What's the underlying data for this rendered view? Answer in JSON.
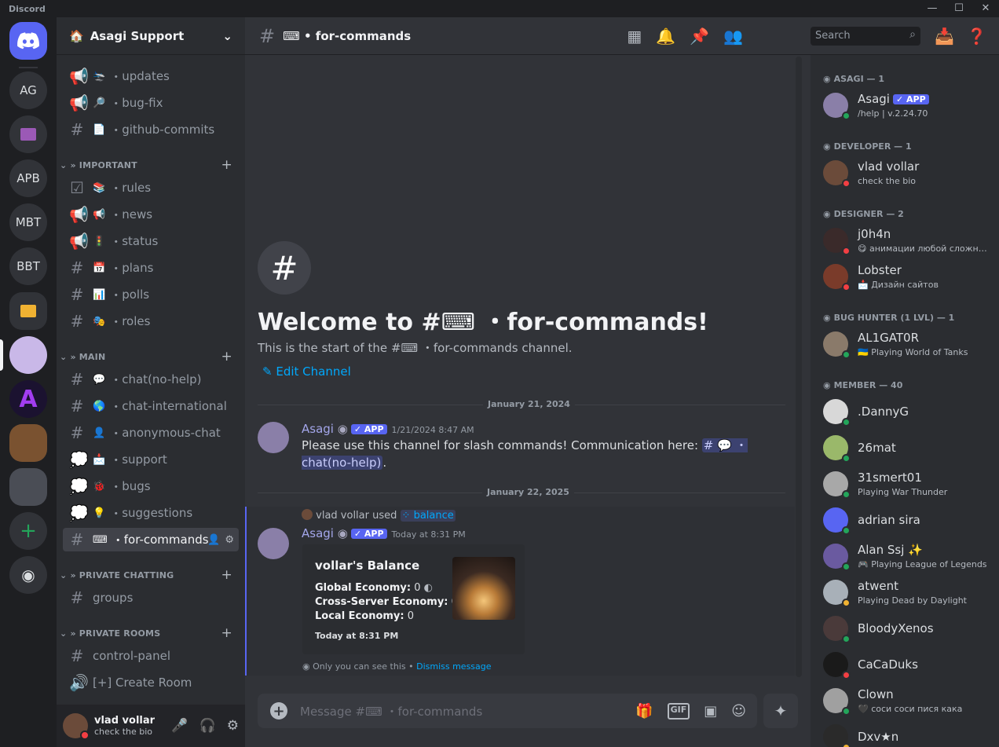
{
  "app": {
    "title": "Discord"
  },
  "window_controls": {
    "minimize": "—",
    "maximize": "☐",
    "close": "✕"
  },
  "guilds": [
    {
      "label": "",
      "icon": "discord-logo-icon"
    },
    {
      "label": "AG"
    },
    {
      "label": "■"
    },
    {
      "label": "APB"
    },
    {
      "label": "MBT"
    },
    {
      "label": "BBT"
    },
    {
      "label": "■"
    }
  ],
  "server": {
    "name": "Asagi Support"
  },
  "channels_top": [
    {
      "label": "updates",
      "emoji": "🛬"
    },
    {
      "label": "bug-fix",
      "emoji": "🔎"
    },
    {
      "label": "github-commits",
      "emoji": "📄"
    }
  ],
  "categories": {
    "important": "» IMPORTANT",
    "main": "» MAIN",
    "private_chatting": "» PRIVATE CHATTING",
    "private_rooms": "» PRIVATE ROOMS"
  },
  "channels_important": [
    {
      "label": "rules",
      "emoji": "📚"
    },
    {
      "label": "news",
      "emoji": "📢"
    },
    {
      "label": "status",
      "emoji": "🚦"
    },
    {
      "label": "plans",
      "emoji": "📅"
    },
    {
      "label": "polls",
      "emoji": "📊"
    },
    {
      "label": "roles",
      "emoji": "🎭"
    }
  ],
  "channels_main": [
    {
      "label": "chat(no-help)",
      "emoji": "💬"
    },
    {
      "label": "chat-international",
      "emoji": "🌎"
    },
    {
      "label": "anonymous-chat",
      "emoji": "👤"
    },
    {
      "label": "support",
      "emoji": "📩"
    },
    {
      "label": "bugs",
      "emoji": "🐞"
    },
    {
      "label": "suggestions",
      "emoji": "💡"
    },
    {
      "label": "for-commands",
      "emoji": "⌨"
    }
  ],
  "channels_private": [
    {
      "label": "groups"
    }
  ],
  "channels_rooms": [
    {
      "label": "control-panel"
    },
    {
      "label": "[+] Create Room"
    }
  ],
  "user": {
    "name": "vlad vollar",
    "status": "check the bio"
  },
  "topbar": {
    "channel": "⌨ • for-commands",
    "search_placeholder": "Search"
  },
  "welcome": {
    "title": "Welcome to #⌨ ・for-commands!",
    "subtitle": "This is the start of the #⌨ ・for-commands channel.",
    "edit": "Edit Channel"
  },
  "dates": {
    "d1": "January 21, 2024",
    "d2": "January 22, 2025"
  },
  "messages": [
    {
      "author": "Asagi",
      "badge": "✓ APP",
      "time": "1/21/2024 8:47 AM",
      "text": "Please use this channel for slash commands! Communication here: ",
      "mention": "# 💬 ・chat(no-help)",
      "after": "."
    },
    {
      "reply_user": "vlad vollar",
      "reply_used": "used",
      "reply_cmd": "balance",
      "author": "Asagi",
      "badge": "✓ APP",
      "time": "Today at 8:31 PM"
    }
  ],
  "embed": {
    "title": "vollar's Balance",
    "f1_label": "Global Economy:",
    "f1_value": "0",
    "f2_label": "Cross-Server Economy:",
    "f2_value": "0",
    "f3_label": "Local Economy:",
    "f3_value": "0",
    "footer": "Today at 8:31 PM"
  },
  "ephemeral": {
    "text": "Only you can see this • ",
    "link": "Dismiss message"
  },
  "composer": {
    "placeholder": "Message #⌨ ・for-commands"
  },
  "member_groups": [
    {
      "label": "ASAGI — 1",
      "members": [
        {
          "name": "Asagi",
          "badge": "✓ APP",
          "sub": "/help | v.2.24.70",
          "status": "on",
          "color": "#8a7fa8"
        }
      ]
    },
    {
      "label": "DEVELOPER — 1",
      "members": [
        {
          "name": "vlad vollar",
          "sub": "check the bio",
          "status": "dnd",
          "color": "#6b4b3a"
        }
      ]
    },
    {
      "label": "DESIGNER — 2",
      "members": [
        {
          "name": "j0h4n",
          "sub": "😋 анимации любой сложности",
          "status": "dnd",
          "color": "#3a2a2a"
        },
        {
          "name": "Lobster",
          "sub": "📩 Дизайн сайтов",
          "status": "dnd",
          "color": "#7a3b2a"
        }
      ]
    },
    {
      "label": "BUG HUNTER (1 LVL) — 1",
      "members": [
        {
          "name": "AL1GAT0R",
          "sub": "🇺🇦 Playing World of Tanks",
          "status": "on",
          "color": "#8a7a6a"
        }
      ]
    },
    {
      "label": "MEMBER — 40",
      "members": [
        {
          "name": ".DannyG",
          "sub": "",
          "status": "on",
          "color": "#d8d8d8"
        },
        {
          "name": "26mat",
          "sub": "",
          "status": "on",
          "color": "#9ab86a"
        },
        {
          "name": "31smert01",
          "sub": "Playing War Thunder",
          "status": "on",
          "color": "#a8a8a8"
        },
        {
          "name": "adrian sira",
          "sub": "",
          "status": "on",
          "color": "#5865f2"
        },
        {
          "name": "Alan Ssj ✨",
          "sub": "🎮 Playing League of Legends",
          "status": "on",
          "color": "#6a5aa0"
        },
        {
          "name": "atwent",
          "sub": "Playing Dead by Daylight",
          "status": "idle",
          "color": "#a8b0b8"
        },
        {
          "name": "BloodyXenos",
          "sub": "",
          "status": "on",
          "color": "#4a3a3a"
        },
        {
          "name": "CaCaDuks",
          "sub": "",
          "status": "dnd",
          "color": "#1a1a1a"
        },
        {
          "name": "Clown",
          "sub": "🖤 соси соси пися кака",
          "status": "on",
          "color": "#a0a0a0"
        },
        {
          "name": "Dxv★n",
          "sub": "",
          "status": "idle",
          "color": "#2a2a2a"
        }
      ]
    }
  ]
}
